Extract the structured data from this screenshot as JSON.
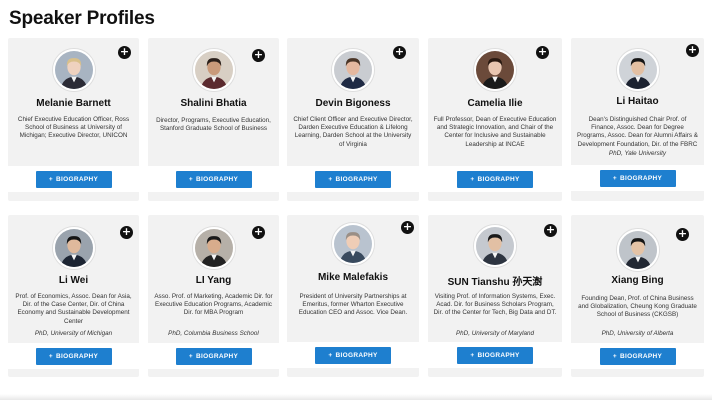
{
  "page": {
    "title": "Speaker Profiles"
  },
  "biography_label": "BIOGRAPHY",
  "plus_glyph": "+",
  "button_color": "#1e7fcf",
  "speakers": [
    {
      "name": "Melanie Barnett",
      "desc": "Chief Executive Education Officer, Ross School of Business at University of Michigan; Executive Director, UNICON",
      "phd": ""
    },
    {
      "name": "Shalini Bhatia",
      "desc": "Director, Programs, Executive Education, Stanford Graduate School of Business",
      "phd": ""
    },
    {
      "name": "Devin Bigoness",
      "desc": "Chief Client Officer and Executive Director, Darden Executive Education & Lifelong Learning, Darden School at the University of Virginia",
      "phd": ""
    },
    {
      "name": "Camelia Ilie",
      "desc": "Full Professor, Dean of Executive Education and Strategic Innovation, and Chair of the Center for Inclusive and Sustainable Leadership at INCAE",
      "phd": ""
    },
    {
      "name": "Li Haitao",
      "desc": "Dean's Distinguished Chair Prof. of Finance, Assoc. Dean for Degree Programs, Assoc. Dean for Alumni Affairs & Development Foundation, Dir. of the FBRC",
      "phd": "PhD, Yale University"
    },
    {
      "name": "Li Wei",
      "desc": "Prof. of Economics, Assoc. Dean for Asia, Dir. of the Case Center, Dir. of China Economy and Sustainable Development Center",
      "phd": "PhD, University of Michigan"
    },
    {
      "name": "LI Yang",
      "desc": "Asso. Prof. of Marketing, Academic Dir. for Executive Education Programs, Academic Dir. for MBA Program",
      "phd": "PhD, Columbia Business School"
    },
    {
      "name": "Mike Malefakis",
      "desc": "President of University Partnerships at Emeritus, former Wharton Executive Education CEO and Assoc. Vice Dean.",
      "phd": ""
    },
    {
      "name": "SUN Tianshu 孙天澍",
      "desc": "Visiting Prof. of Information Systems, Exec. Acad. Dir. for Business Scholars Program, Dir. of the Center for Tech, Big Data and DT.",
      "phd": "PhD, University of Maryland"
    },
    {
      "name": "Xiang Bing",
      "desc": "Founding Dean, Prof. of China Business and Globalization, Cheung Kong Graduate School of Business (CKGSB)",
      "phd": "PhD, University of Alberta"
    }
  ]
}
